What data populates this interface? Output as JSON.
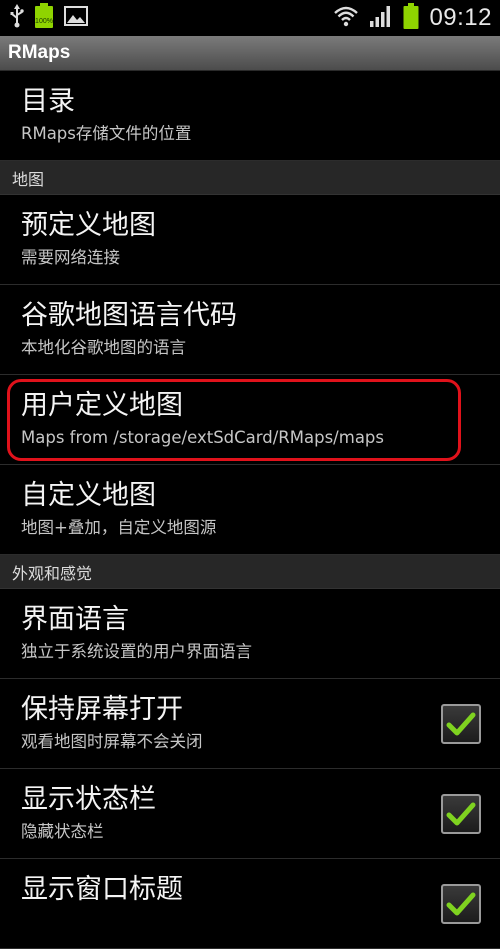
{
  "status_bar": {
    "time": "09:12",
    "icons": [
      "usb-icon",
      "battery-100-icon",
      "image-icon",
      "wifi-icon",
      "signal-icon",
      "battery-icon"
    ],
    "battery_label": "100%"
  },
  "app_title": "RMaps",
  "items": {
    "directory": {
      "title": "目录",
      "summary": "RMaps存储文件的位置"
    },
    "section_map": "地图",
    "predefined_maps": {
      "title": "预定义地图",
      "summary": "需要网络连接"
    },
    "google_lang": {
      "title": "谷歌地图语言代码",
      "summary": "本地化谷歌地图的语言"
    },
    "user_maps": {
      "title": "用户定义地图",
      "summary": "Maps from /storage/extSdCard/RMaps/maps"
    },
    "custom_maps": {
      "title": "自定义地图",
      "summary": "地图+叠加，自定义地图源"
    },
    "section_look": "外观和感觉",
    "ui_language": {
      "title": "界面语言",
      "summary": "独立于系统设置的用户界面语言"
    },
    "keep_screen_on": {
      "title": "保持屏幕打开",
      "summary": "观看地图时屏幕不会关闭",
      "checked": true
    },
    "show_status_bar": {
      "title": "显示状态栏",
      "summary": "隐藏状态栏",
      "checked": true
    },
    "show_window_title": {
      "title": "显示窗口标题",
      "checked": true
    }
  },
  "colors": {
    "highlight": "#e0121b",
    "check": "#7fd320",
    "battery": "#8fd400"
  }
}
